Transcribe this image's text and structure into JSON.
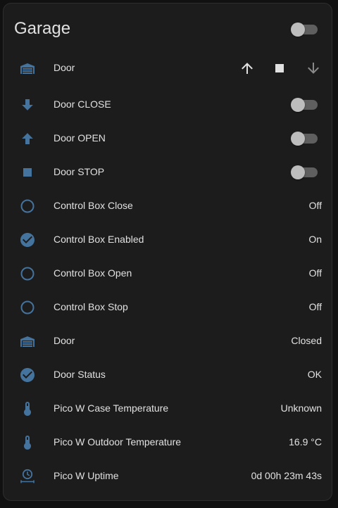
{
  "card": {
    "title": "Garage"
  },
  "colors": {
    "icon": "#44739e",
    "text": "#e1e1e1",
    "background": "#1c1c1c",
    "toggle_track": "#5f5f5f",
    "toggle_thumb": "#bdbdbd",
    "disabled": "#8a8a8a"
  },
  "rows": [
    {
      "label": "Door",
      "icon": "garage-icon",
      "control": "cover-buttons"
    },
    {
      "label": "Door CLOSE",
      "icon": "arrow-down-bold-icon",
      "control": "toggle",
      "state": "off"
    },
    {
      "label": "Door OPEN",
      "icon": "arrow-up-bold-icon",
      "control": "toggle",
      "state": "off"
    },
    {
      "label": "Door STOP",
      "icon": "stop-icon",
      "control": "toggle",
      "state": "off"
    },
    {
      "label": "Control Box Close",
      "icon": "checkbox-blank-circle-outline-icon",
      "value": "Off"
    },
    {
      "label": "Control Box Enabled",
      "icon": "check-circle-icon",
      "value": "On"
    },
    {
      "label": "Control Box Open",
      "icon": "checkbox-blank-circle-outline-icon",
      "value": "Off"
    },
    {
      "label": "Control Box Stop",
      "icon": "checkbox-blank-circle-outline-icon",
      "value": "Off"
    },
    {
      "label": "Door",
      "icon": "garage-icon",
      "value": "Closed"
    },
    {
      "label": "Door Status",
      "icon": "check-circle-icon",
      "value": "OK"
    },
    {
      "label": "Pico W Case Temperature",
      "icon": "thermometer-icon",
      "value": "Unknown"
    },
    {
      "label": "Pico W Outdoor Temperature",
      "icon": "thermometer-icon",
      "value": "16.9 °C"
    },
    {
      "label": "Pico W Uptime",
      "icon": "clock-timer-icon",
      "value": "0d 00h 23m 43s"
    }
  ]
}
